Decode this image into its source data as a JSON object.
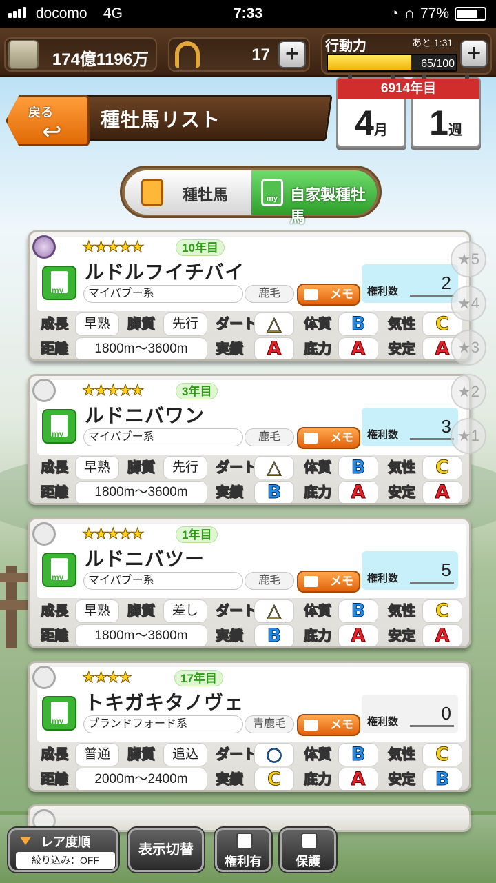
{
  "status": {
    "carrier": "docomo",
    "network": "4G",
    "time": "7:33",
    "battery": "77%"
  },
  "resources": {
    "money": "174億1196万",
    "horseshoes": "17",
    "stamina_label": "行動力",
    "stamina_remaining": "あと 1:31",
    "stamina_value": "65/100",
    "stamina_fraction": 0.65
  },
  "header": {
    "back_label": "戻る",
    "title": "種牡馬リスト",
    "year": "6914年目",
    "month": "4",
    "month_unit": "月",
    "week": "1",
    "week_unit": "週"
  },
  "tabs": [
    {
      "label": "種牡馬",
      "active": false
    },
    {
      "label": "自家製種牡馬",
      "active": true
    }
  ],
  "tab_my_icon": "my",
  "side_filters": [
    "★5",
    "★4",
    "★3",
    "★2",
    "★1"
  ],
  "labels": {
    "rights": "権利数",
    "memo": "メモ",
    "growth": "成長",
    "leg": "脚質",
    "dirt": "ダート",
    "body": "体質",
    "temper": "気性",
    "distance": "距離",
    "record": "実績",
    "power": "底力",
    "stable": "安定",
    "my": "my"
  },
  "horses": [
    {
      "stars": "★★★★★",
      "year": "10年目",
      "name": "ルドルフイチバイ",
      "line": "マイバブー系",
      "coat": "鹿毛",
      "rights": "2",
      "growth": "早熟",
      "leg": "先行",
      "dirt": "△",
      "body": "B",
      "temper": "C",
      "distance": "1800m～3600m",
      "record": "A",
      "power": "A",
      "stable": "A",
      "highlight": true
    },
    {
      "stars": "★★★★★",
      "year": "3年目",
      "name": "ルドニバワン",
      "line": "マイバブー系",
      "coat": "鹿毛",
      "rights": "3",
      "growth": "早熟",
      "leg": "先行",
      "dirt": "△",
      "body": "B",
      "temper": "C",
      "distance": "1800m～3600m",
      "record": "B",
      "power": "A",
      "stable": "A",
      "highlight": false
    },
    {
      "stars": "★★★★★",
      "year": "1年目",
      "name": "ルドニバツー",
      "line": "マイバブー系",
      "coat": "鹿毛",
      "rights": "5",
      "growth": "早熟",
      "leg": "差し",
      "dirt": "△",
      "body": "B",
      "temper": "C",
      "distance": "1800m～3600m",
      "record": "B",
      "power": "A",
      "stable": "A",
      "highlight": false
    },
    {
      "stars": "★★★★",
      "year": "17年目",
      "name": "トキガキタノヴェ",
      "line": "ブランドフォード系",
      "coat": "青鹿毛",
      "rights": "0",
      "growth": "普通",
      "leg": "追込",
      "dirt": "○",
      "body": "B",
      "temper": "C",
      "distance": "2000m～2400m",
      "record": "C",
      "power": "A",
      "stable": "B",
      "highlight": false
    }
  ],
  "bottom": {
    "sort_label": "レア度順",
    "filter_label": "絞り込み：OFF",
    "switch_label": "表示切替",
    "rights_check": "権利有",
    "protect_check": "保護"
  },
  "colors": {
    "grade_A": "#e3202a",
    "grade_B": "#1f8ee8",
    "grade_C": "#f6d01c",
    "my_green": "#3cb534",
    "memo_orange": "#e1620c",
    "calendar_red": "#d22d2d"
  },
  "icons": {
    "money": "money-stack-icon",
    "horseshoe": "horseshoe-icon",
    "back": "back-arrow-icon",
    "file": "file-icon"
  }
}
